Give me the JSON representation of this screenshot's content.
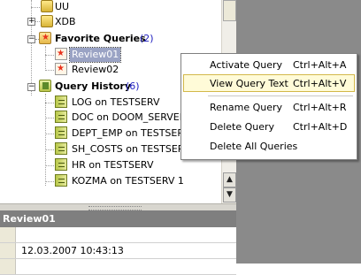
{
  "tree": {
    "items_top": [
      {
        "label": "UU"
      },
      {
        "label": "XDB"
      }
    ],
    "favorites": {
      "label": "Favorite Queries",
      "count": "(2)",
      "expander": "−",
      "items": [
        {
          "label": "Review01"
        },
        {
          "label": "Review02"
        }
      ]
    },
    "history": {
      "label": "Query History",
      "count": "(6)",
      "expander": "−",
      "items": [
        {
          "label": "LOG on TESTSERV"
        },
        {
          "label": "DOC on DOOM_SERVER"
        },
        {
          "label": "DEPT_EMP on TESTSERV"
        },
        {
          "label": "SH_COSTS on TESTSERV"
        },
        {
          "label": "HR on TESTSERV"
        },
        {
          "label": "KOZMA on TESTSERV 1"
        }
      ]
    },
    "xdb_expander": "+"
  },
  "scrollbar": {
    "up": "▲",
    "down": "▼"
  },
  "info_panel": {
    "title": "Review01",
    "rows": [
      {
        "value": ""
      },
      {
        "value": "12.03.2007 10:43:13"
      },
      {
        "value": ""
      }
    ]
  },
  "context_menu": {
    "items": [
      {
        "label": "Activate Query",
        "shortcut": "Ctrl+Alt+A"
      },
      {
        "label": "View Query Text",
        "shortcut": "Ctrl+Alt+V"
      },
      {
        "label": "Rename Query",
        "shortcut": "Ctrl+Alt+R"
      },
      {
        "label": "Delete Query",
        "shortcut": "Ctrl+Alt+D"
      },
      {
        "label": "Delete All Queries",
        "shortcut": ""
      }
    ]
  },
  "colors": {
    "count_blue": "#2020c0",
    "selection": "#9aa3c4",
    "menu_highlight": "#fffbd8",
    "menu_highlight_border": "#d3b84a"
  }
}
